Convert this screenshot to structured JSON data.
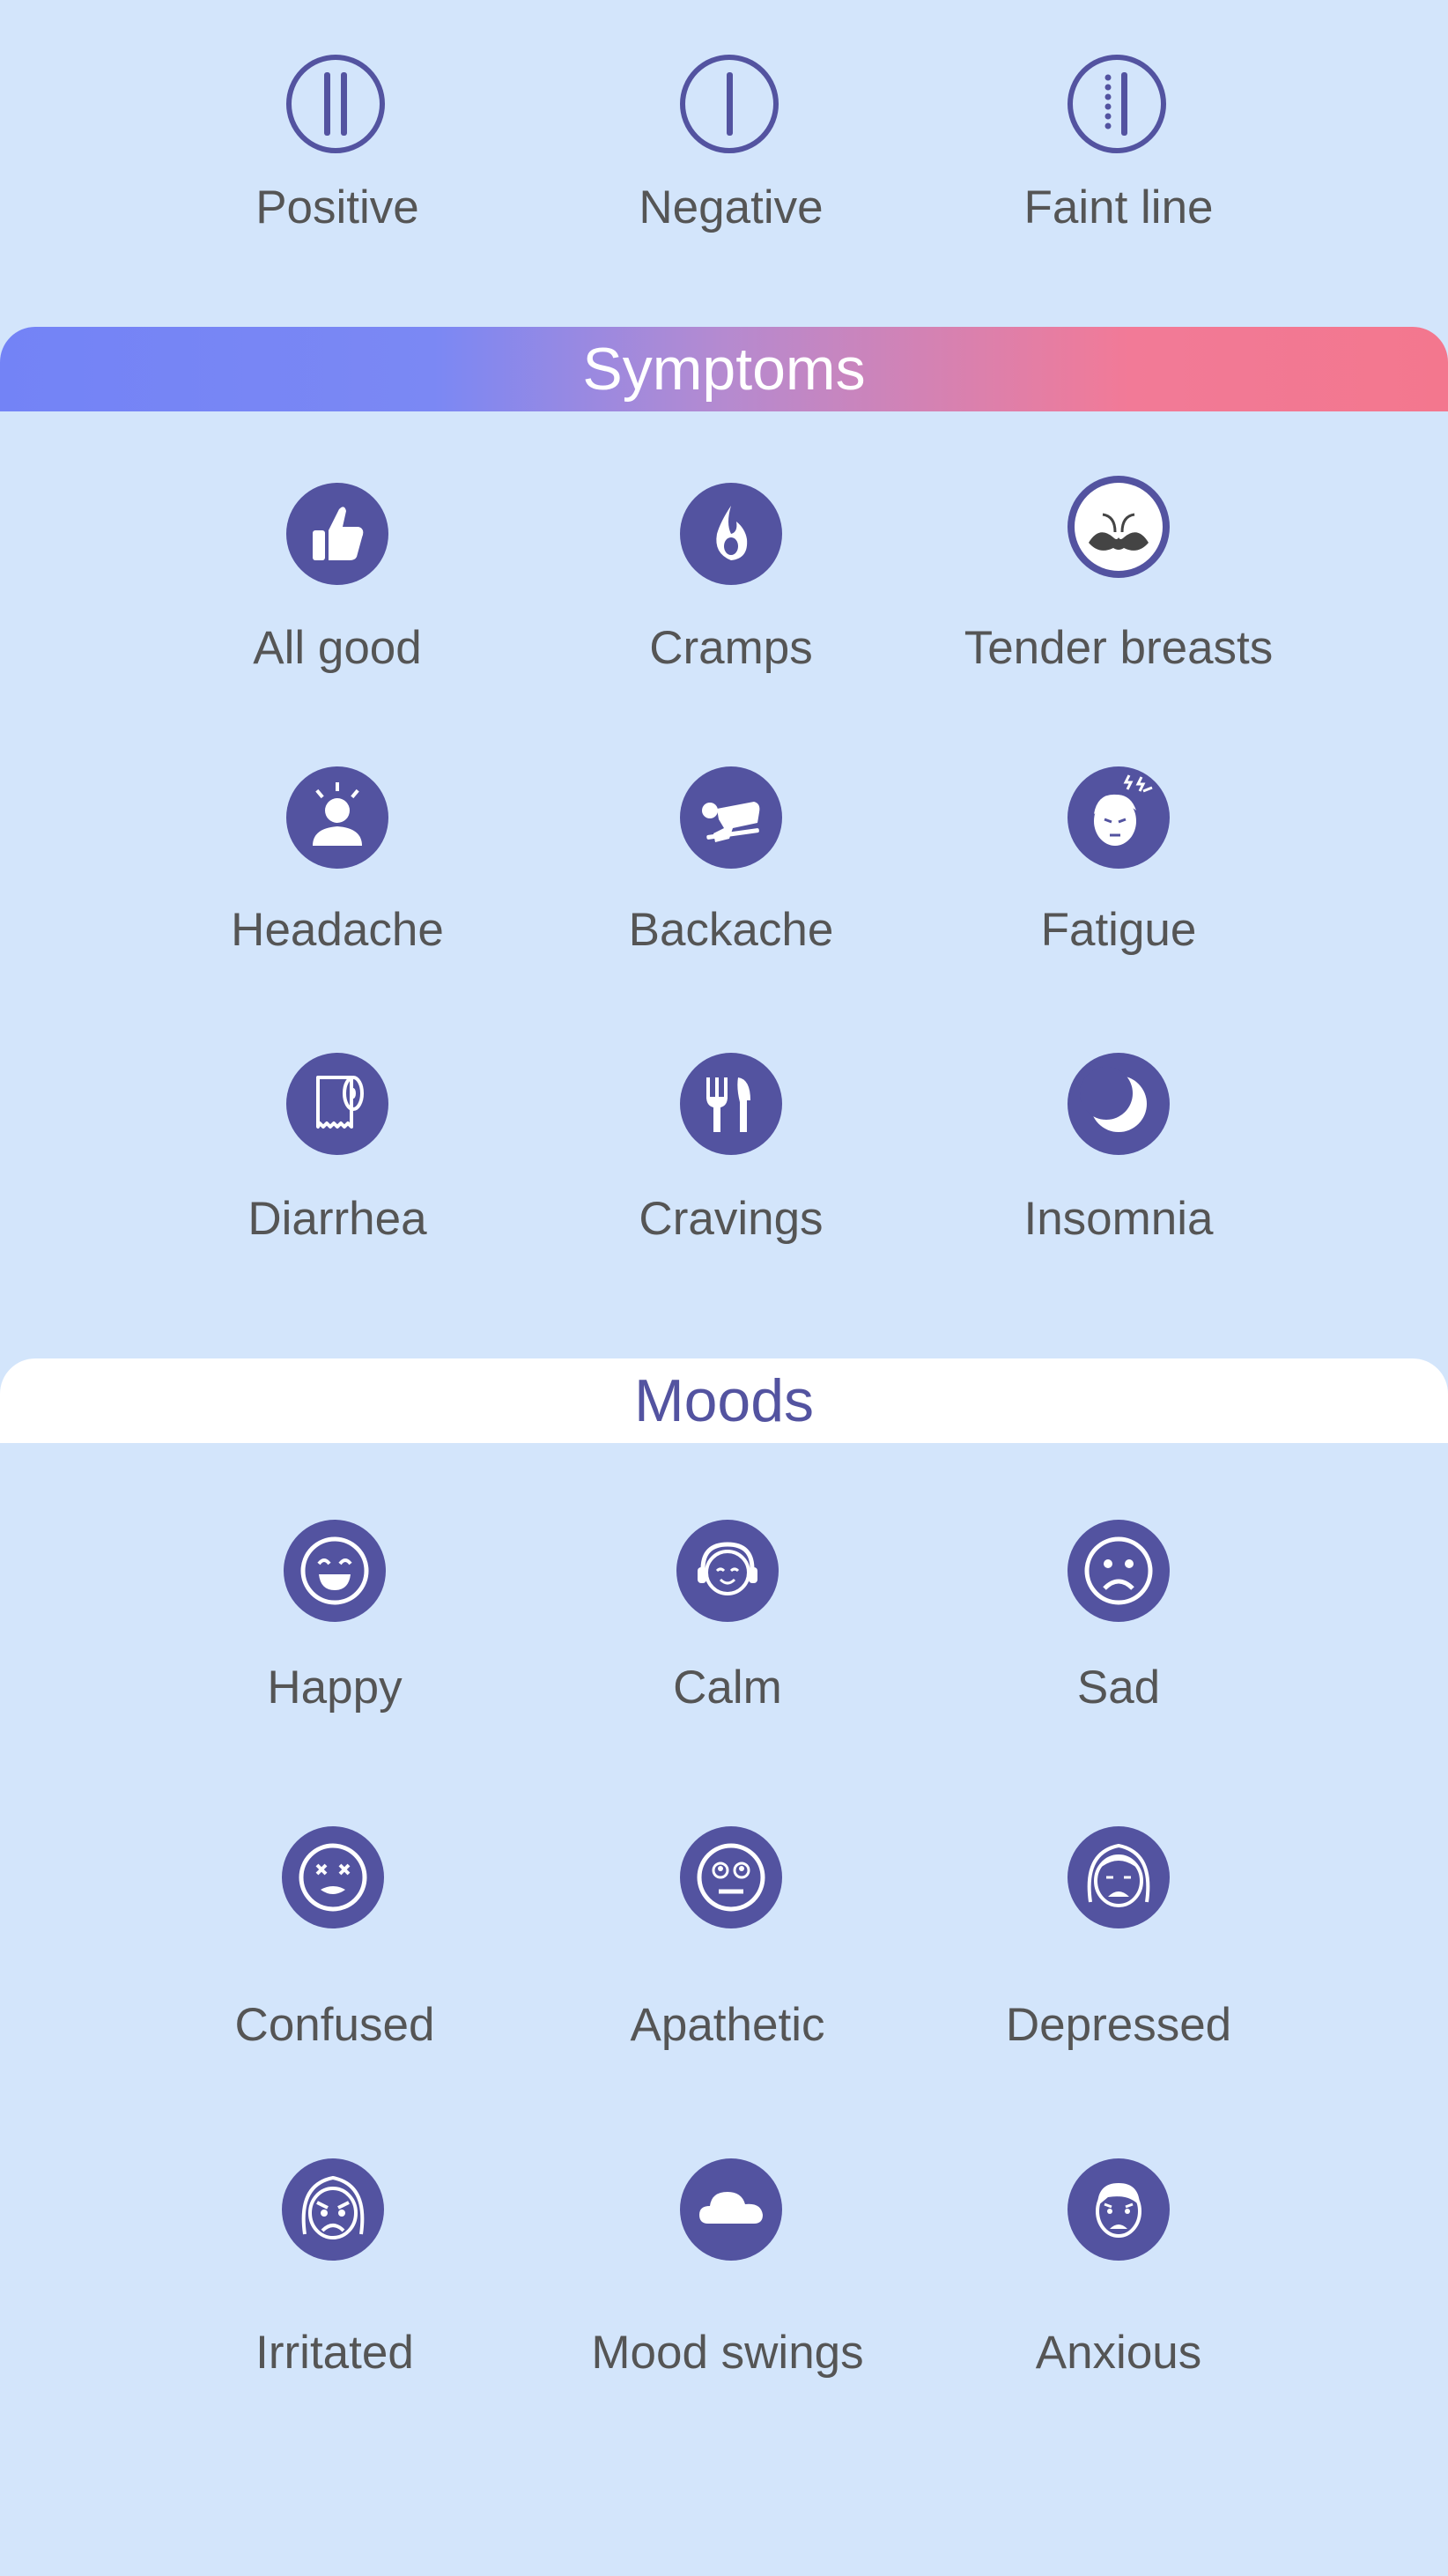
{
  "test_results": [
    {
      "label": "Positive",
      "icon": "double-line-icon"
    },
    {
      "label": "Negative",
      "icon": "single-line-icon"
    },
    {
      "label": "Faint line",
      "icon": "faint-line-icon"
    }
  ],
  "symptoms": {
    "title": "Symptoms",
    "items": [
      {
        "label": "All good",
        "icon": "thumbs-up-icon"
      },
      {
        "label": "Cramps",
        "icon": "flame-icon"
      },
      {
        "label": "Tender breasts",
        "icon": "breasts-icon"
      },
      {
        "label": "Headache",
        "icon": "headache-icon"
      },
      {
        "label": "Backache",
        "icon": "backache-icon"
      },
      {
        "label": "Fatigue",
        "icon": "fatigue-face-icon"
      },
      {
        "label": "Diarrhea",
        "icon": "toilet-paper-icon"
      },
      {
        "label": "Cravings",
        "icon": "fork-knife-icon"
      },
      {
        "label": "Insomnia",
        "icon": "moon-icon"
      }
    ]
  },
  "moods": {
    "title": "Moods",
    "items": [
      {
        "label": "Happy",
        "icon": "happy-face-icon"
      },
      {
        "label": "Calm",
        "icon": "calm-face-icon"
      },
      {
        "label": "Sad",
        "icon": "sad-face-icon"
      },
      {
        "label": "Confused",
        "icon": "confused-face-icon"
      },
      {
        "label": "Apathetic",
        "icon": "apathetic-face-icon"
      },
      {
        "label": "Depressed",
        "icon": "depressed-face-icon"
      },
      {
        "label": "Irritated",
        "icon": "irritated-face-icon"
      },
      {
        "label": "Mood swings",
        "icon": "cloud-icon"
      },
      {
        "label": "Anxious",
        "icon": "anxious-face-icon"
      }
    ]
  },
  "colors": {
    "background": "#d3e5fb",
    "icon": "#5353a0",
    "label": "#555555"
  }
}
